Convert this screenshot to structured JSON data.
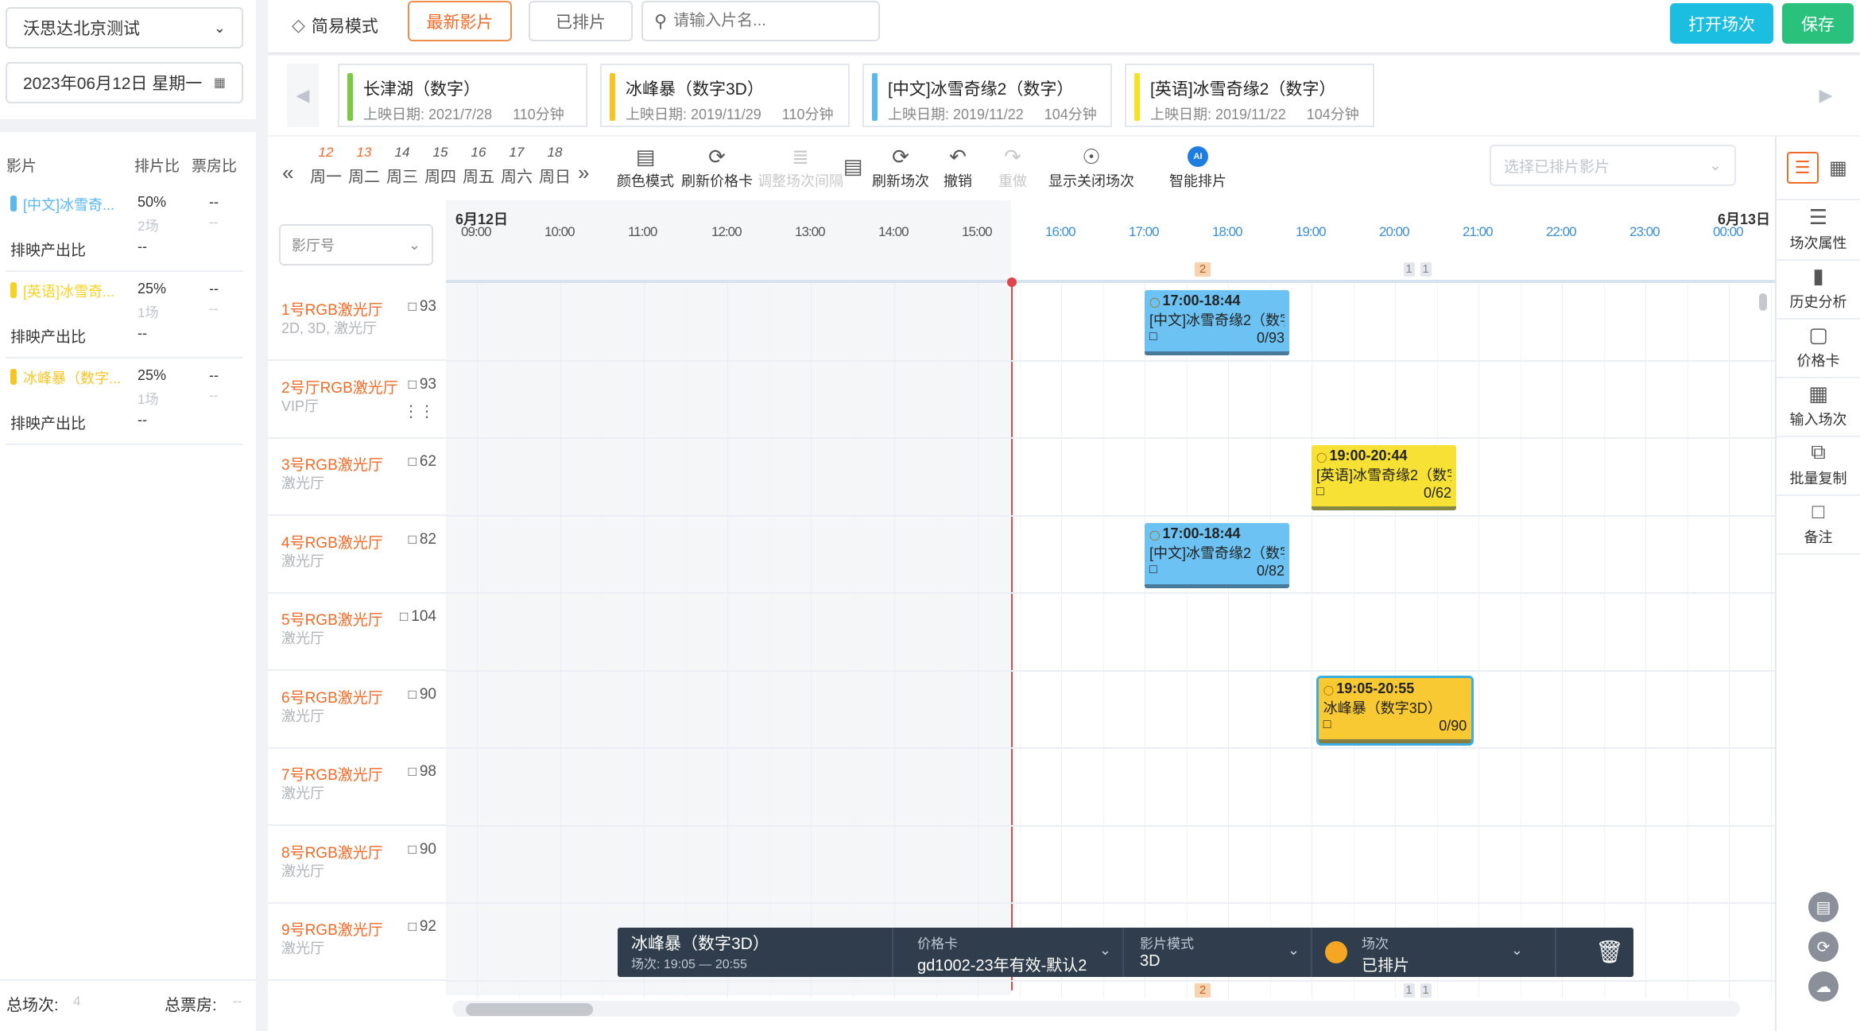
{
  "left": {
    "cinema": "沃思达北京测试",
    "date": "2023年06月12日 星期一",
    "headers": {
      "film": "影片",
      "ratio": "排片比",
      "box": "票房比"
    },
    "films": [
      {
        "name": "[中文]冰雪奇...",
        "ratio": "50%",
        "box": "--",
        "count": "2场",
        "count_box": "--",
        "color": "#5ab8ef",
        "output_label": "排映产出比",
        "output_value": "--"
      },
      {
        "name": "[英语]冰雪奇...",
        "ratio": "25%",
        "box": "--",
        "count": "1场",
        "count_box": "--",
        "color": "#f6d321",
        "output_label": "排映产出比",
        "output_value": "--"
      },
      {
        "name": "冰峰暴（数字...",
        "ratio": "25%",
        "box": "--",
        "count": "1场",
        "count_box": "--",
        "color": "#f6c521",
        "output_label": "排映产出比",
        "output_value": "--"
      }
    ],
    "footer": {
      "total_label": "总场次:",
      "total_value": "4",
      "box_label": "总票房:",
      "box_value": "--"
    }
  },
  "topbar": {
    "simple_mode": "简易模式",
    "tab_latest": "最新影片",
    "tab_scheduled": "已排片",
    "search_placeholder": "请输入片名...",
    "open_sessions": "打开场次",
    "save": "保存"
  },
  "filmstrip": [
    {
      "title": "长津湖（数字）",
      "date": "上映日期: 2021/7/28",
      "duration": "110分钟",
      "color": "#7ac943"
    },
    {
      "title": "冰峰暴（数字3D）",
      "date": "上映日期: 2019/11/29",
      "duration": "110分钟",
      "color": "#f6c521"
    },
    {
      "title": "[中文]冰雪奇缘2（数字）",
      "date": "上映日期: 2019/11/22",
      "duration": "104分钟",
      "color": "#5ab8ef"
    },
    {
      "title": "[英语]冰雪奇缘2（数字）",
      "date": "上映日期: 2019/11/22",
      "duration": "104分钟",
      "color": "#f6e221"
    }
  ],
  "days": [
    {
      "n": "12",
      "w": "周一",
      "today": true
    },
    {
      "n": "13",
      "w": "周二",
      "today": true
    },
    {
      "n": "14",
      "w": "周三"
    },
    {
      "n": "15",
      "w": "周四"
    },
    {
      "n": "16",
      "w": "周五"
    },
    {
      "n": "17",
      "w": "周六"
    },
    {
      "n": "18",
      "w": "周日"
    }
  ],
  "tools": {
    "color_mode": "颜色模式",
    "refresh_price": "刷新价格卡",
    "adjust_interval": "调整场次间隔",
    "refresh_sessions": "刷新场次",
    "undo": "撤销",
    "redo": "重做",
    "show_closed": "显示关闭场次",
    "smart_schedule": "智能排片",
    "ai_badge": "AI",
    "film_select_placeholder": "选择已排片影片"
  },
  "rightpanel": [
    "场次属性",
    "历史分析",
    "价格卡",
    "输入场次",
    "批量复制",
    "备注"
  ],
  "schedule": {
    "hall_select": "影厅号",
    "date_start": "6月12日",
    "date_end": "6月13日",
    "hours": [
      "09:00",
      "10:00",
      "11:00",
      "12:00",
      "13:00",
      "14:00",
      "15:00",
      "16:00",
      "17:00",
      "18:00",
      "19:00",
      "20:00",
      "21:00",
      "22:00",
      "23:00",
      "00:00"
    ],
    "top_counts": [
      {
        "label": "2",
        "type": "orange"
      },
      {
        "label": "1",
        "type": "gray"
      },
      {
        "label": "1",
        "type": "gray"
      }
    ],
    "halls": [
      {
        "name": "1号RGB激光厅",
        "type": "2D, 3D, 激光厅",
        "cap": "93"
      },
      {
        "name": "2号厅RGB激光厅",
        "type": "VIP厅",
        "cap": "93"
      },
      {
        "name": "3号RGB激光厅",
        "type": "激光厅",
        "cap": "62"
      },
      {
        "name": "4号RGB激光厅",
        "type": "激光厅",
        "cap": "82"
      },
      {
        "name": "5号RGB激光厅",
        "type": "激光厅",
        "cap": "104"
      },
      {
        "name": "6号RGB激光厅",
        "type": "激光厅",
        "cap": "90"
      },
      {
        "name": "7号RGB激光厅",
        "type": "激光厅",
        "cap": "98"
      },
      {
        "name": "8号RGB激光厅",
        "type": "激光厅",
        "cap": "90"
      },
      {
        "name": "9号RGB激光厅",
        "type": "激光厅",
        "cap": "92"
      }
    ],
    "sessions": [
      {
        "hall": 0,
        "time": "17:00-18:44",
        "movie": "[中文]冰雪奇缘2（数字",
        "seats": "0/93",
        "color": "#6cc3f3"
      },
      {
        "hall": 2,
        "time": "19:00-20:44",
        "movie": "[英语]冰雪奇缘2（数字",
        "seats": "0/62",
        "color": "#f7e135"
      },
      {
        "hall": 3,
        "time": "17:00-18:44",
        "movie": "[中文]冰雪奇缘2（数字",
        "seats": "0/82",
        "color": "#6cc3f3"
      },
      {
        "hall": 5,
        "time": "19:05-20:55",
        "movie": "冰峰暴（数字3D）",
        "seats": "0/90",
        "color": "#f8c933"
      }
    ]
  },
  "infobar": {
    "movie": "冰峰暴（数字3D）",
    "session_time": "场次: 19:05 — 20:55",
    "price_label": "价格卡",
    "price_value": "gd1002-23年有效-默认2",
    "mode_label": "影片模式",
    "mode_value": "3D",
    "status_label": "场次",
    "status_value": "已排片",
    "status_color": "#f5a623"
  }
}
